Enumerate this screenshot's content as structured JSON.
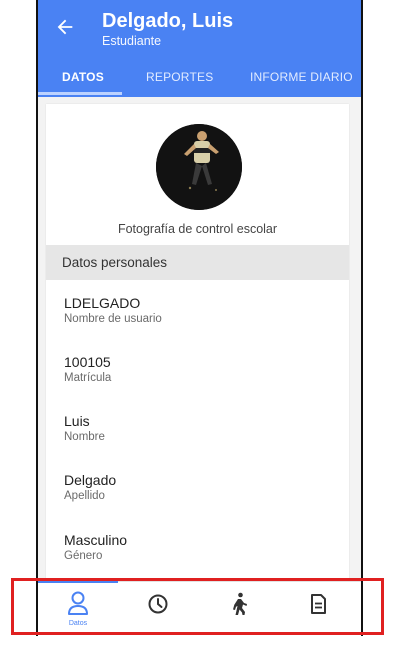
{
  "header": {
    "title": "Delgado, Luis",
    "subtitle": "Estudiante"
  },
  "tabs": [
    {
      "label": "DATOS",
      "active": true
    },
    {
      "label": "REPORTES",
      "active": false
    },
    {
      "label": "INFORME DIARIO",
      "active": false
    }
  ],
  "profile": {
    "photo_caption": "Fotografía de control escolar"
  },
  "section": {
    "title": "Datos personales"
  },
  "fields": [
    {
      "value": "LDELGADO",
      "label": "Nombre de usuario"
    },
    {
      "value": "100105",
      "label": "Matrícula"
    },
    {
      "value": "Luis",
      "label": "Nombre"
    },
    {
      "value": "Delgado",
      "label": "Apellido"
    },
    {
      "value": "Masculino",
      "label": "Género"
    }
  ],
  "bottom_nav": {
    "items": [
      {
        "icon": "user-icon",
        "caption": "Datos",
        "active": true
      },
      {
        "icon": "clock-icon",
        "active": false
      },
      {
        "icon": "walking-person-icon",
        "active": false
      },
      {
        "icon": "document-icon",
        "active": false
      }
    ]
  },
  "colors": {
    "primary": "#4a82f3",
    "highlight": "#e02020",
    "section_bg": "#e6e6e6"
  }
}
